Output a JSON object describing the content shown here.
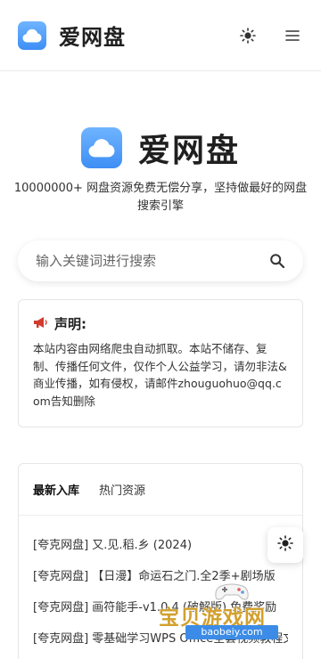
{
  "header": {
    "brand": "爱网盘",
    "theme_icon": "sun-icon",
    "menu_icon": "menu-icon"
  },
  "hero": {
    "title": "爱网盘",
    "tagline": "10000000+ 网盘资源免费无偿分享，坚持做最好的网盘搜索引擎"
  },
  "search": {
    "placeholder": "输入关键词进行搜索",
    "icon": "search-icon"
  },
  "notice": {
    "title": "声明:",
    "icon": "megaphone-icon",
    "body": "本站内容由网络爬虫自动抓取。本站不储存、复制、传播任何文件，仅作个人公益学习，请勿非法&商业传播，如有侵权，请邮件zhouguohuo@qq.com告知删除"
  },
  "panel": {
    "tabs": [
      {
        "label": "最新入库"
      },
      {
        "label": "热门资源"
      }
    ],
    "items": [
      {
        "text": "[夸克网盘] 又.见.稻.乡 (2024)"
      },
      {
        "text": "[夸克网盘] 【日漫】命运石之门.全2季+剧场版"
      },
      {
        "text": "[夸克网盘] 画符能手-v1.0.4 (破解版) 免费奖励"
      },
      {
        "text": "[夸克网盘] 零基础学习WPS Office全套视频教程文件"
      }
    ]
  },
  "float": {
    "icon": "sun-icon"
  },
  "watermark": {
    "text": "宝贝游戏网",
    "url": "baobeiy.com"
  },
  "colors": {
    "logo_gradient_top": "#6fb4ff",
    "logo_gradient_bottom": "#3d8ef5",
    "watermark_gold": "#d2a02e",
    "watermark_blue": "#3c8ce7"
  }
}
